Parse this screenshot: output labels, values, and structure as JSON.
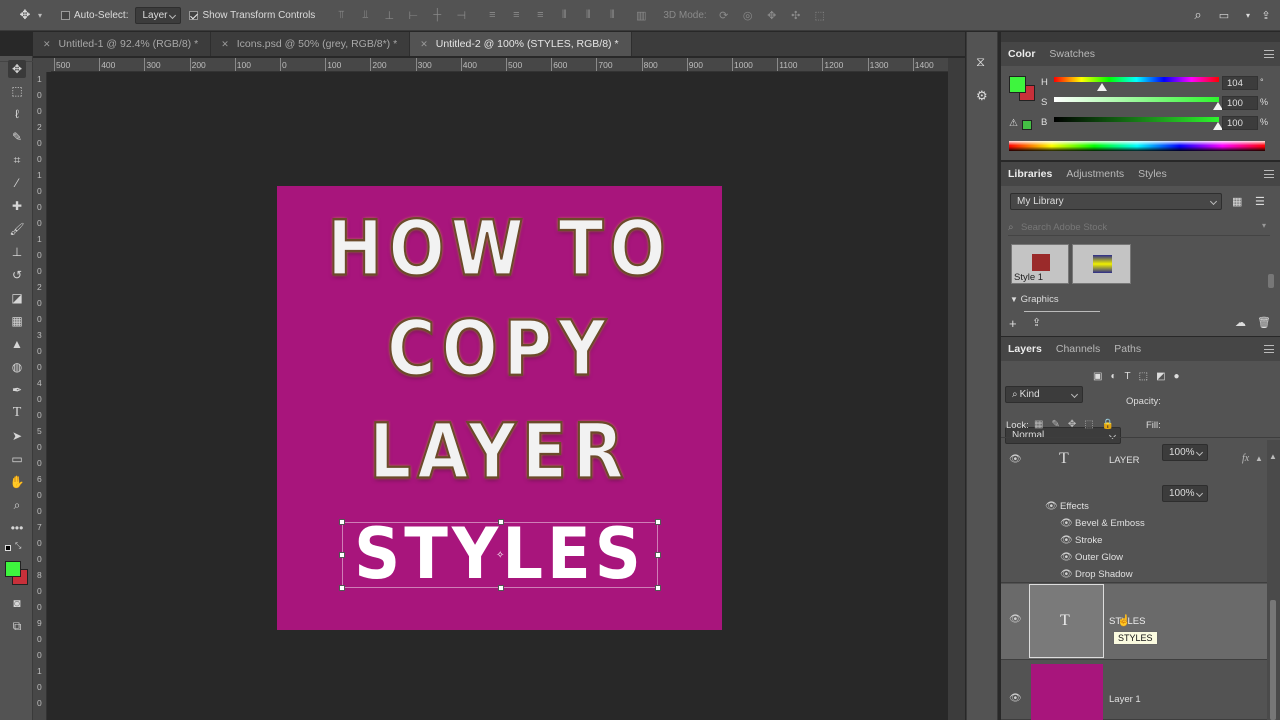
{
  "options_bar": {
    "auto_select_label": "Auto-Select:",
    "auto_select_value": "Layer",
    "show_transform_label": "Show Transform Controls",
    "mode_3d_label": "3D Mode:"
  },
  "tabs": [
    {
      "label": "Untitled-1 @ 92.4% (RGB/8) *"
    },
    {
      "label": "Icons.psd @ 50% (grey, RGB/8*) *"
    },
    {
      "label": "Untitled-2 @ 100% (STYLES, RGB/8) *"
    }
  ],
  "ruler": {
    "h_ticks": [
      "500",
      "400",
      "300",
      "200",
      "100",
      "0",
      "100",
      "200",
      "300",
      "400",
      "500",
      "600",
      "700",
      "800",
      "900",
      "1000",
      "1100",
      "1200",
      "1300",
      "1400"
    ],
    "v_ticks": [
      "1",
      "0",
      "0",
      "2",
      "0",
      "0",
      "1",
      "0",
      "0",
      "0",
      "1",
      "0",
      "0",
      "2",
      "0",
      "0",
      "3",
      "0",
      "0",
      "4",
      "0",
      "0",
      "5",
      "0",
      "0",
      "6",
      "0",
      "0",
      "7",
      "0",
      "0",
      "8",
      "0",
      "0",
      "9",
      "0",
      "0",
      "1",
      "0",
      "0"
    ]
  },
  "canvas": {
    "background": "#a8157c",
    "lines": [
      "HOW TO",
      "COPY",
      "LAYER"
    ],
    "selected_text": "STYLES"
  },
  "color_panel": {
    "tabs": [
      "Color",
      "Swatches"
    ],
    "rows": [
      {
        "label": "H",
        "value": "104",
        "unit": "°"
      },
      {
        "label": "S",
        "value": "100",
        "unit": "%"
      },
      {
        "label": "B",
        "value": "100",
        "unit": "%"
      }
    ],
    "foreground": "#3ef53e",
    "background_color": "#c8303a"
  },
  "libraries_panel": {
    "tabs": [
      "Libraries",
      "Adjustments",
      "Styles"
    ],
    "library_select": "My Library",
    "search_placeholder": "Search Adobe Stock",
    "item1_label": "Style 1",
    "graphics_label": "Graphics"
  },
  "layers_panel": {
    "tabs": [
      "Layers",
      "Channels",
      "Paths"
    ],
    "filter": "Kind",
    "blend_mode": "Normal",
    "opacity_label": "Opacity:",
    "opacity_value": "100%",
    "lock_label": "Lock:",
    "fill_label": "Fill:",
    "fill_value": "100%",
    "layers": [
      {
        "name": "LAYER",
        "fx": "fx"
      },
      {
        "name": "STYLES"
      },
      {
        "name": "Layer 1"
      }
    ],
    "effects_label": "Effects",
    "effects": [
      "Bevel & Emboss",
      "Stroke",
      "Outer Glow",
      "Drop Shadow"
    ],
    "tooltip": "STYLES"
  }
}
